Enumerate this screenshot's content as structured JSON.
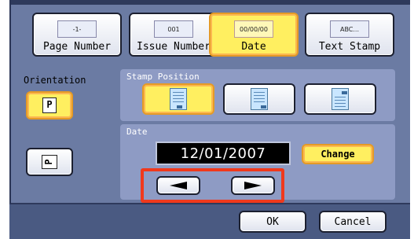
{
  "tabs": [
    {
      "icon_text": "-1-",
      "label": "Page Number",
      "selected": false
    },
    {
      "icon_text": "001",
      "label": "Issue Number",
      "selected": false
    },
    {
      "icon_text": "00/00/00",
      "label": "Date",
      "selected": true
    },
    {
      "icon_text": "ABC...",
      "label": "Text Stamp",
      "selected": false
    }
  ],
  "orientation": {
    "label": "Orientation",
    "portrait_glyph": "P",
    "landscape_glyph": "P"
  },
  "stamp_position": {
    "title": "Stamp Position",
    "options": [
      "bottom",
      "bottom-right",
      "top-right"
    ],
    "selected": "bottom"
  },
  "date": {
    "title": "Date",
    "value": "12/01/2007",
    "change_label": "Change",
    "left_arrow": "left-arrow",
    "right_arrow": "right-arrow"
  },
  "footer": {
    "ok_label": "OK",
    "cancel_label": "Cancel"
  },
  "colors": {
    "panel": "#6b7ba3",
    "selected": "#ffef60",
    "highlight": "#f0391c"
  }
}
